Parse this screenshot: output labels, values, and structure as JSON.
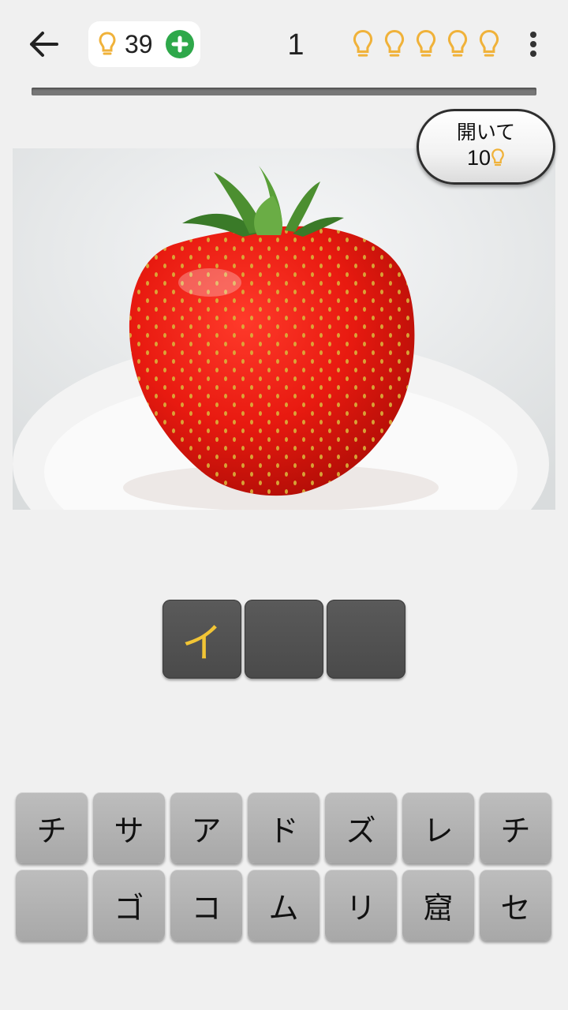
{
  "header": {
    "back_icon": "arrow-left-icon",
    "hints_count": "39",
    "hint_icon": "lightbulb-icon",
    "add_hints_icon": "plus-circle-icon",
    "level_number": "1",
    "level_bulbs": 5,
    "menu_icon": "more-vertical-icon",
    "colors": {
      "bulb": "#f0b23a",
      "plus": "#2ea84a"
    }
  },
  "progress": {
    "fraction": 0
  },
  "image": {
    "subject_icon": "strawberry-image"
  },
  "reveal_button": {
    "label": "開いて",
    "cost": "10"
  },
  "answer": {
    "slots": [
      "イ",
      "",
      ""
    ],
    "color": "#f2c535"
  },
  "keyboard": {
    "rows": [
      [
        "チ",
        "サ",
        "ア",
        "ド",
        "ズ",
        "レ",
        "チ"
      ],
      [
        "",
        "ゴ",
        "コ",
        "ム",
        "リ",
        "窟",
        "セ"
      ]
    ]
  }
}
